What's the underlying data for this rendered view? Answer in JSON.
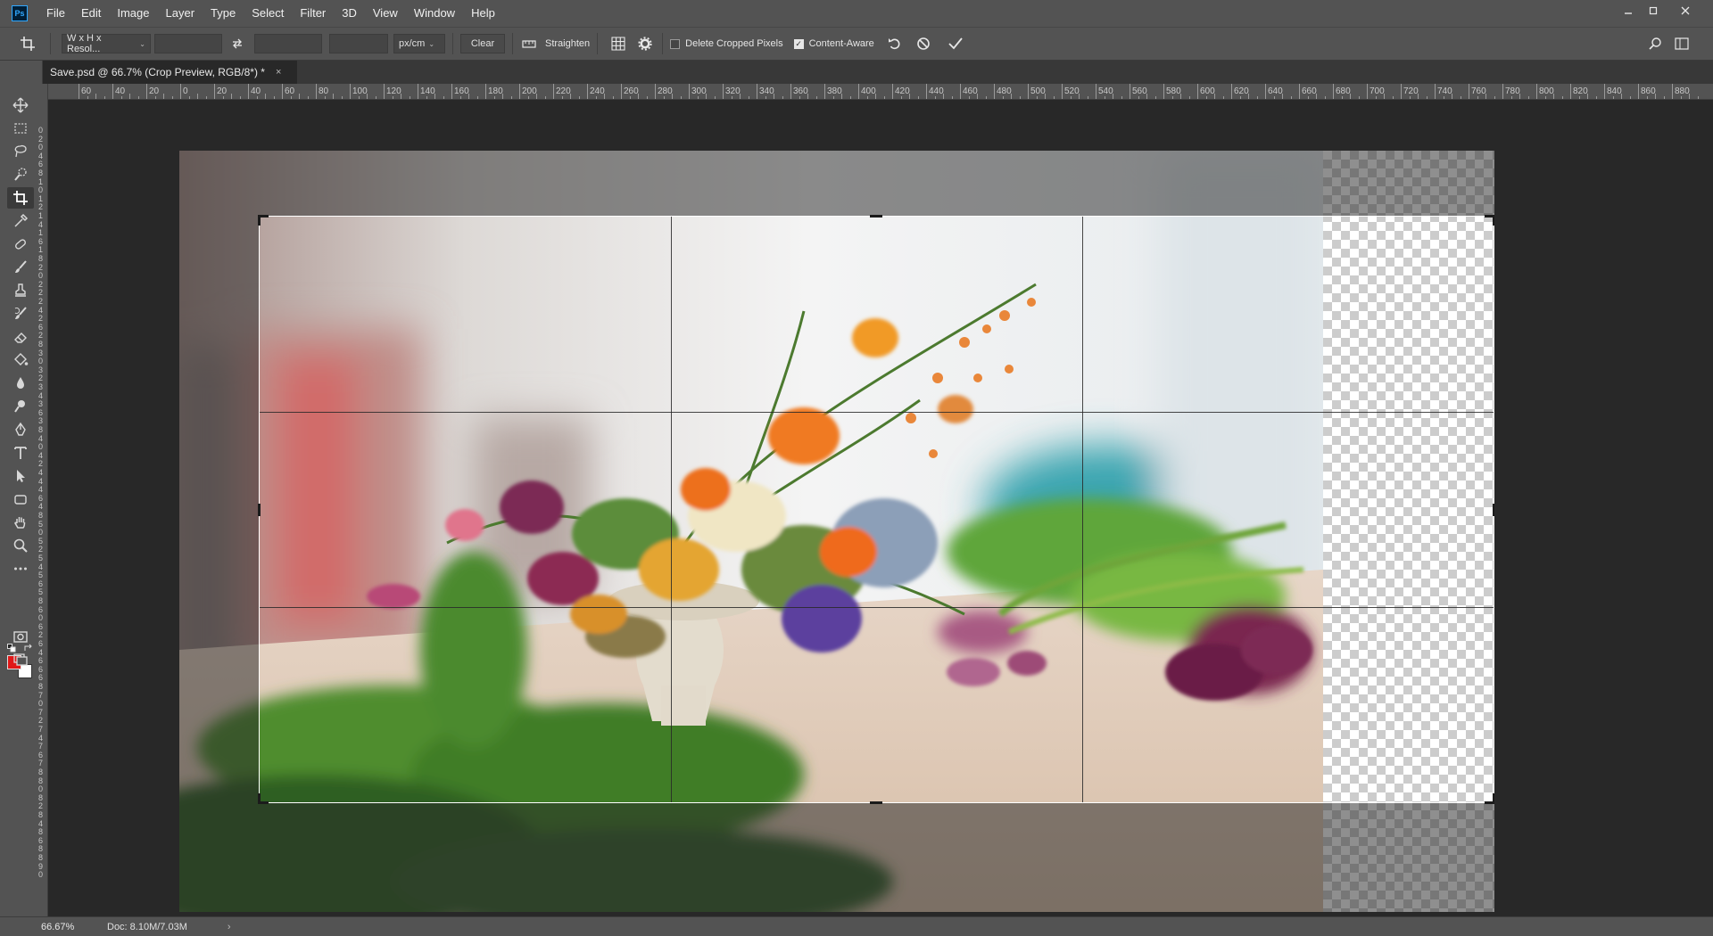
{
  "app": {
    "logo_text": "Ps",
    "menu": [
      "File",
      "Edit",
      "Image",
      "Layer",
      "Type",
      "Select",
      "Filter",
      "3D",
      "View",
      "Window",
      "Help"
    ],
    "window_controls": [
      "minimize",
      "maximize",
      "close"
    ]
  },
  "options": {
    "ratio_preset": "W x H x Resol...",
    "width_value": "",
    "height_value": "",
    "resolution_value": "",
    "units": "px/cm",
    "clear_label": "Clear",
    "straighten_label": "Straighten",
    "delete_cropped_label": "Delete Cropped Pixels",
    "delete_cropped_checked": false,
    "content_aware_label": "Content-Aware",
    "content_aware_checked": true
  },
  "document": {
    "tab_title": "Save.psd @ 66.7% (Crop Preview, RGB/8*) *",
    "tab_close": "×"
  },
  "ruler": {
    "h_labels": [
      "60",
      "40",
      "20",
      "0",
      "20",
      "40",
      "60",
      "80",
      "100",
      "120",
      "140",
      "160",
      "180",
      "200",
      "220",
      "240",
      "260",
      "280",
      "300",
      "320",
      "340",
      "360",
      "380",
      "400",
      "420",
      "440",
      "460",
      "480",
      "500",
      "520",
      "540",
      "560",
      "580",
      "600",
      "620",
      "640",
      "660",
      "680",
      "700",
      "720",
      "740",
      "760",
      "780",
      "800",
      "820",
      "840",
      "860",
      "880"
    ],
    "v_labels": [
      "0",
      "2",
      "0",
      "4",
      "6",
      "8",
      "1",
      "0",
      "1",
      "2",
      "1",
      "4",
      "1",
      "6",
      "1",
      "8",
      "2",
      "0",
      "2",
      "2",
      "2",
      "4",
      "2",
      "6",
      "2",
      "8",
      "3",
      "0",
      "3",
      "2",
      "3",
      "4",
      "3",
      "6",
      "3",
      "8",
      "4",
      "0",
      "4",
      "2",
      "4",
      "4",
      "4",
      "6",
      "4",
      "8",
      "5",
      "0",
      "5",
      "2",
      "5",
      "4",
      "5",
      "6",
      "5",
      "8",
      "6",
      "0",
      "6",
      "2",
      "6",
      "4",
      "6",
      "6",
      "6",
      "8",
      "7",
      "0",
      "7",
      "2",
      "7",
      "4",
      "7",
      "6",
      "7",
      "8",
      "8",
      "0",
      "8",
      "2",
      "8",
      "4",
      "8",
      "6",
      "8",
      "8",
      "9",
      "0"
    ]
  },
  "tools": [
    "move-tool",
    "marquee-tool",
    "lasso-tool",
    "quick-selection-tool",
    "crop-tool",
    "eyedropper-tool",
    "healing-brush-tool",
    "brush-tool",
    "clone-stamp-tool",
    "history-brush-tool",
    "eraser-tool",
    "paint-bucket-tool",
    "blur-tool",
    "dodge-tool",
    "pen-tool",
    "type-tool",
    "path-selection-tool",
    "rectangle-tool",
    "hand-tool",
    "zoom-tool",
    "more-tools"
  ],
  "colors": {
    "foreground": "#e01818",
    "background": "#ffffff",
    "crop_frame": "#ffffff",
    "ui_panel": "#535353",
    "canvas_bg": "#282828"
  },
  "status": {
    "zoom": "66.67%",
    "doc_info": "Doc: 8.10M/7.03M",
    "arrow": "›"
  }
}
